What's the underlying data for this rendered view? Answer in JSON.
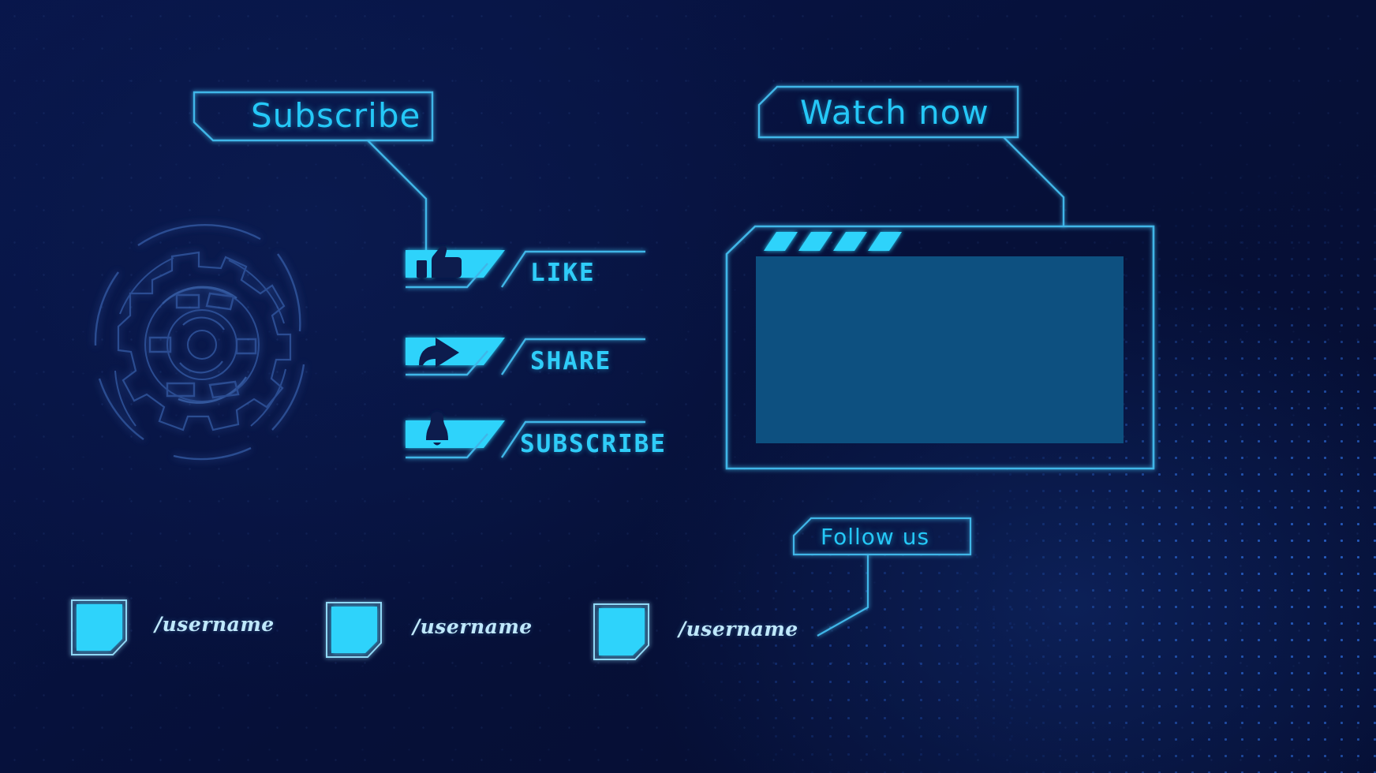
{
  "theme": {
    "background_deep": "#071443",
    "accent_cyan": "#2fd3fb",
    "line_cyan": "#3fb6e8",
    "screen_fill": "#0d5080",
    "text_light": "#bfe8fb"
  },
  "banners": {
    "subscribe": {
      "label": "Subscribe"
    },
    "watch_now": {
      "label": "Watch now"
    },
    "follow_us": {
      "label": "Follow us"
    }
  },
  "actions": [
    {
      "id": "like",
      "label": "LIKE",
      "icon": "thumbs-up-icon"
    },
    {
      "id": "share",
      "label": "SHARE",
      "icon": "share-arrow-icon"
    },
    {
      "id": "subscribe",
      "label": "SUBSCRIBE",
      "icon": "bell-icon"
    }
  ],
  "social": [
    {
      "id": "social-1",
      "handle": "/username",
      "icon": "social-badge-icon"
    },
    {
      "id": "social-2",
      "handle": "/username",
      "icon": "social-badge-icon"
    },
    {
      "id": "social-3",
      "handle": "/username",
      "icon": "social-badge-icon"
    }
  ],
  "player": {
    "name": "video-player-frame",
    "clapper_stripes": 4,
    "screen_label": ""
  },
  "decoration": {
    "hud_circle": "hud-circular-tech-ornament"
  }
}
